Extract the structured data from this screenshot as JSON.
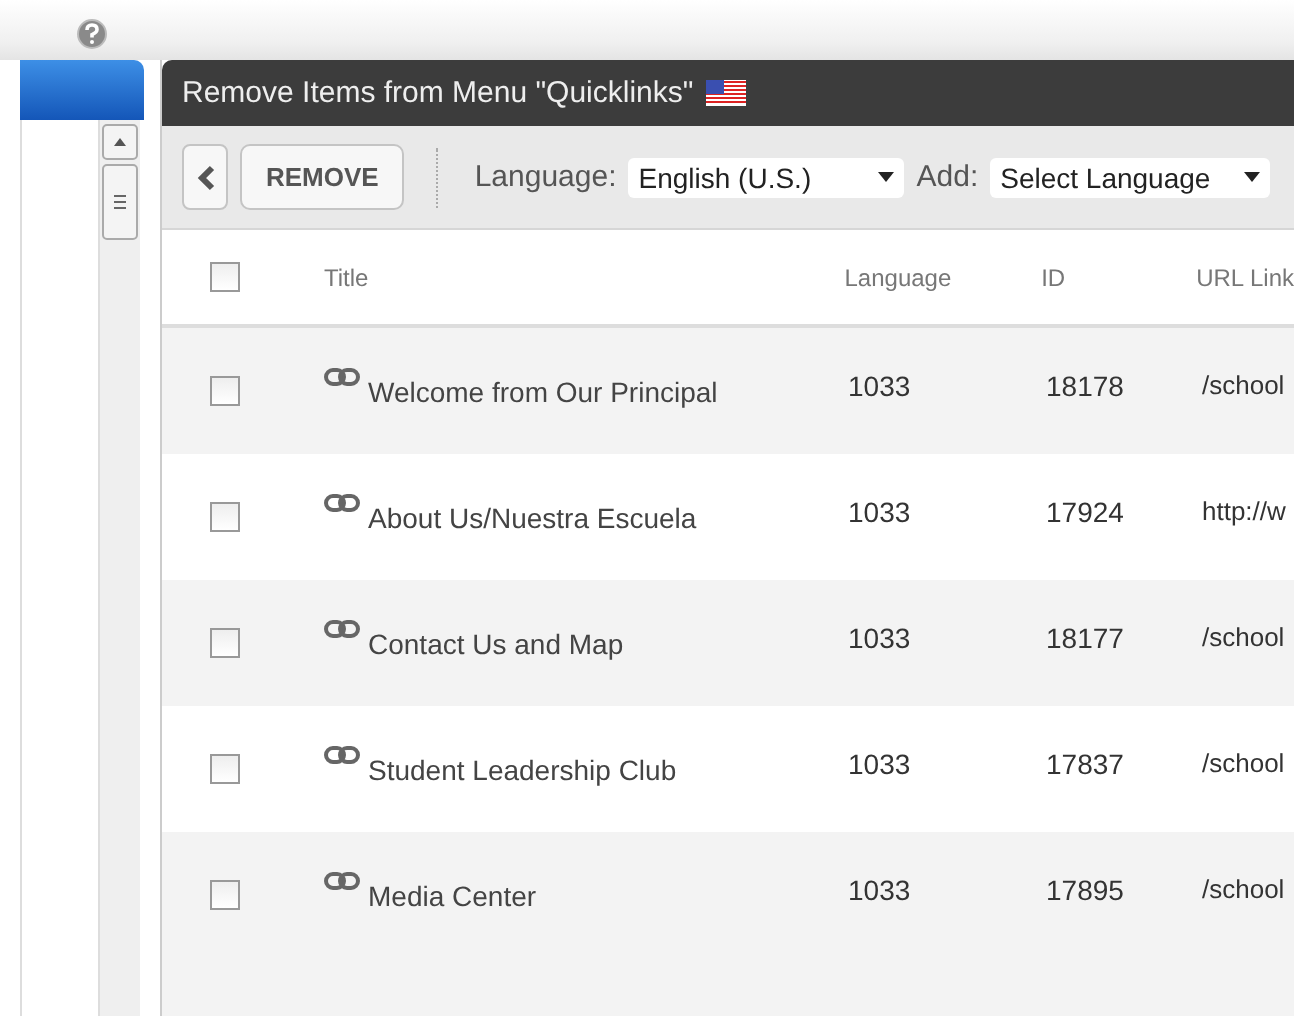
{
  "panel": {
    "title": "Remove Items from Menu \"Quicklinks\""
  },
  "toolbar": {
    "remove_button": "REMOVE",
    "language_label": "Language:",
    "language_value": "English (U.S.)",
    "add_label": "Add:",
    "add_value": "Select Language"
  },
  "table": {
    "columns": [
      "Title",
      "Language",
      "ID",
      "URL Link"
    ],
    "select_all_checked": false,
    "rows": [
      {
        "title": "Welcome from Our Principal",
        "language": "1033",
        "id": "18178",
        "url": "/school",
        "checked": false
      },
      {
        "title": "About Us/Nuestra Escuela",
        "language": "1033",
        "id": "17924",
        "url": "http://w",
        "checked": false
      },
      {
        "title": "Contact Us and Map",
        "language": "1033",
        "id": "18177",
        "url": "/school",
        "checked": false
      },
      {
        "title": "Student Leadership Club",
        "language": "1033",
        "id": "17837",
        "url": "/school",
        "checked": false
      },
      {
        "title": "Media Center",
        "language": "1033",
        "id": "17895",
        "url": "/school",
        "checked": false
      }
    ]
  }
}
